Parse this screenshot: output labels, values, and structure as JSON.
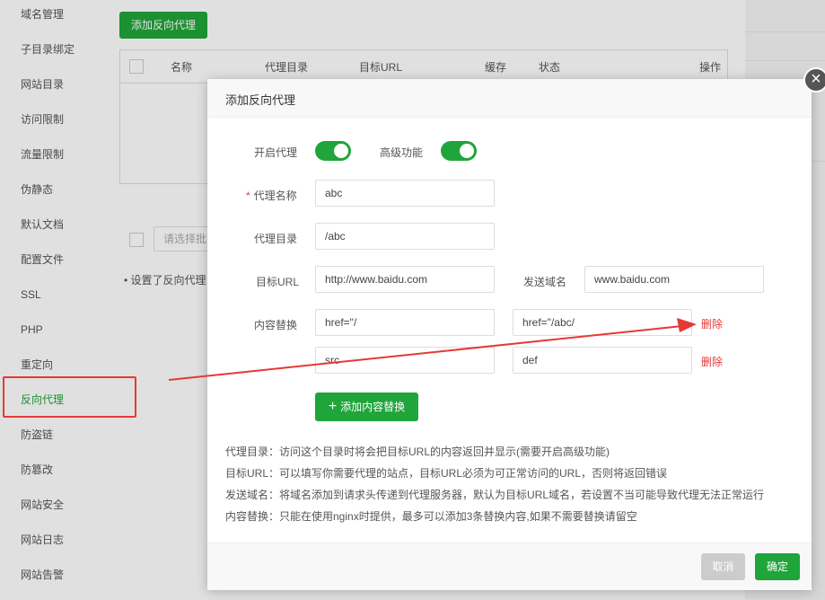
{
  "sidebar": {
    "items": [
      {
        "label": "域名管理"
      },
      {
        "label": "子目录绑定"
      },
      {
        "label": "网站目录"
      },
      {
        "label": "访问限制"
      },
      {
        "label": "流量限制"
      },
      {
        "label": "伪静态"
      },
      {
        "label": "默认文档"
      },
      {
        "label": "配置文件"
      },
      {
        "label": "SSL"
      },
      {
        "label": "PHP"
      },
      {
        "label": "重定向"
      },
      {
        "label": "反向代理"
      },
      {
        "label": "防盗链"
      },
      {
        "label": "防篡改"
      },
      {
        "label": "网站安全"
      },
      {
        "label": "网站日志"
      },
      {
        "label": "网站告警"
      }
    ],
    "active": "反向代理"
  },
  "background": {
    "add_button": "添加反向代理",
    "table_headers": [
      "名称",
      "代理目录",
      "目标URL",
      "缓存",
      "状态",
      "操作"
    ],
    "batch_select_placeholder": "请选择批量操作",
    "note": "设置了反向代理"
  },
  "modal": {
    "title": "添加反向代理",
    "enable_proxy_label": "开启代理",
    "enable_proxy": true,
    "advanced_label": "高级功能",
    "advanced": true,
    "proxy_name_label": "代理名称",
    "proxy_name_value": "abc",
    "proxy_dir_label": "代理目录",
    "proxy_dir_value": "/abc",
    "target_url_label": "目标URL",
    "target_url_value": "http://www.baidu.com",
    "send_domain_label": "发送域名",
    "send_domain_value": "www.baidu.com",
    "content_replace_label": "内容替换",
    "replacements": [
      {
        "from": "href=\"/",
        "to": "href=\"/abc/"
      },
      {
        "from": "src",
        "to": "def"
      }
    ],
    "delete_label": "删除",
    "add_replace_button": "添加内容替换",
    "tips": [
      "代理目录：访问这个目录时将会把目标URL的内容返回并显示(需要开启高级功能)",
      "目标URL：可以填写你需要代理的站点，目标URL必须为可正常访问的URL，否则将返回错误",
      "发送域名：将域名添加到请求头传递到代理服务器，默认为目标URL域名，若设置不当可能导致代理无法正常运行",
      "内容替换：只能在使用nginx时提供，最多可以添加3条替换内容,如果不需要替换请留空"
    ],
    "cancel_label": "取消",
    "confirm_label": "确定"
  },
  "colors": {
    "accent": "#20a53a",
    "danger": "#e53935"
  }
}
